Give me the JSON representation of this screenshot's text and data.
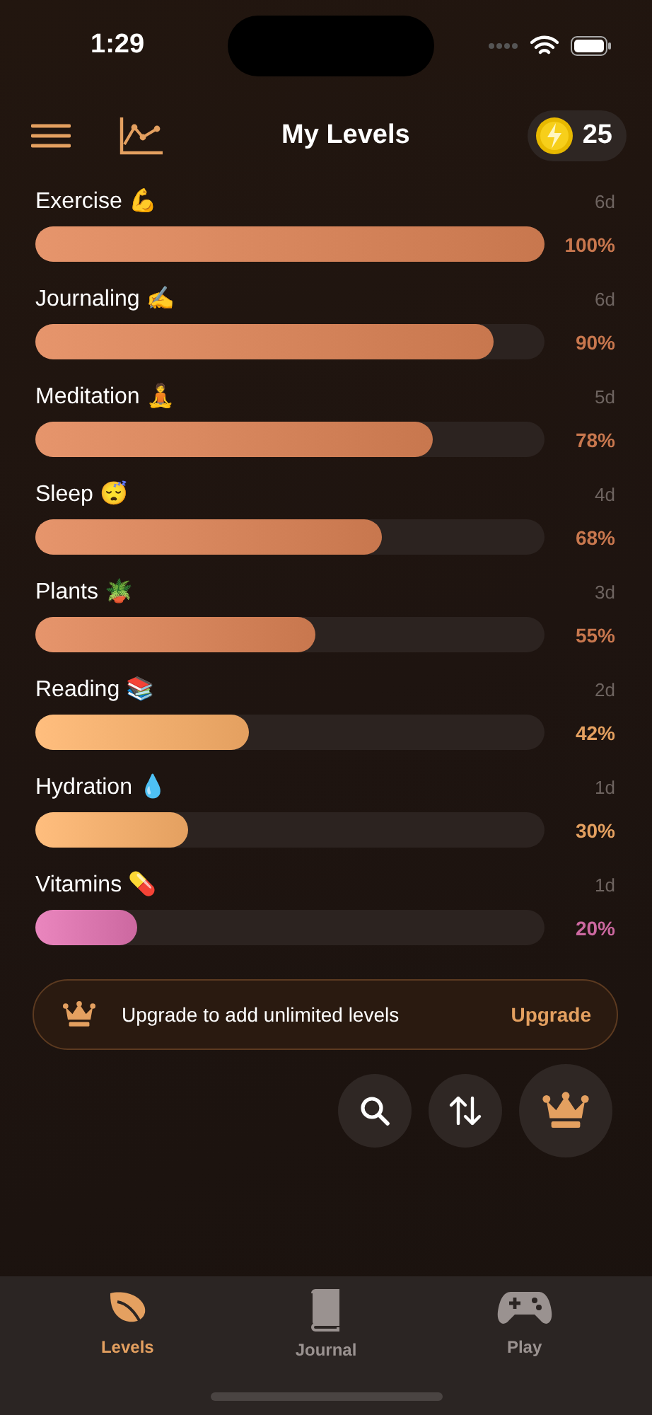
{
  "status_bar": {
    "time": "1:29"
  },
  "header": {
    "title": "My Levels",
    "coins": "25"
  },
  "levels": [
    {
      "name": "Exercise 💪",
      "age": "6d",
      "level": 1.0,
      "reading": "100%",
      "color": "#c8774e"
    },
    {
      "name": "Journaling ✍️",
      "age": "6d",
      "level": 0.9,
      "reading": "90%",
      "color": "#c8774e"
    },
    {
      "name": "Meditation 🧘",
      "age": "5d",
      "level": 0.78,
      "reading": "78%",
      "color": "#c8774e"
    },
    {
      "name": "Sleep 😴",
      "age": "4d",
      "level": 0.68,
      "reading": "68%",
      "color": "#c8774e"
    },
    {
      "name": "Plants 🪴",
      "age": "3d",
      "level": 0.55,
      "reading": "55%",
      "color": "#c8774e"
    },
    {
      "name": "Reading 📚",
      "age": "2d",
      "level": 0.42,
      "reading": "42%",
      "color": "#e4a060"
    },
    {
      "name": "Hydration 💧",
      "age": "1d",
      "level": 0.3,
      "reading": "30%",
      "color": "#e4a060"
    },
    {
      "name": "Vitamins 💊",
      "age": "1d",
      "level": 0.2,
      "reading": "20%",
      "color": "#cc68a0"
    }
  ],
  "upgrade_banner": {
    "text": "Upgrade to add unlimited levels",
    "action": "Upgrade"
  },
  "tab_bar": [
    {
      "label": "Levels",
      "selected": true
    },
    {
      "label": "Journal",
      "selected": false
    },
    {
      "label": "Play",
      "selected": false
    }
  ]
}
